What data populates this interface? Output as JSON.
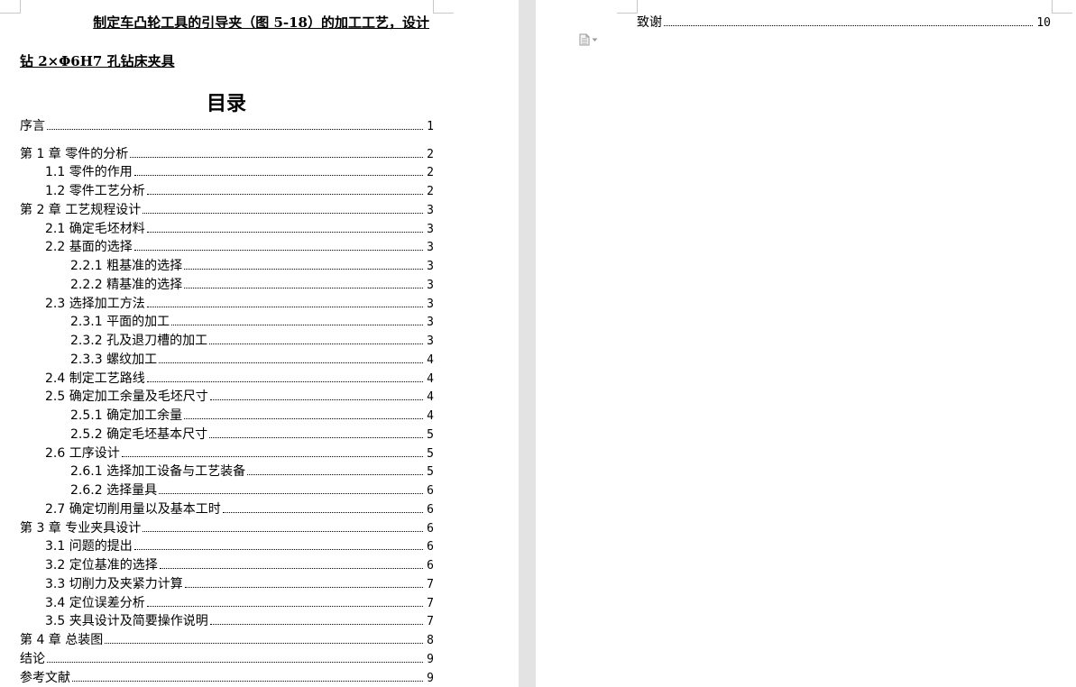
{
  "document": {
    "title": "制定车凸轮工具的引导夹（图 5-18）的加工工艺，设计",
    "subtitle": "钻 2×Φ6H7 孔钻床夹具",
    "toc_heading": "目录"
  },
  "toc_left": [
    {
      "label": "序言",
      "page": "1",
      "level": 0
    },
    {
      "label": "第 1 章  零件的分析",
      "page": "2",
      "level": 0
    },
    {
      "label": "1.1 零件的作用",
      "page": "2",
      "level": 1
    },
    {
      "label": "1.2 零件工艺分析",
      "page": "2",
      "level": 1
    },
    {
      "label": "第 2 章  工艺规程设计",
      "page": "3",
      "level": 0
    },
    {
      "label": "2.1 确定毛坯材料",
      "page": "3",
      "level": 1
    },
    {
      "label": "2.2 基面的选择",
      "page": "3",
      "level": 1
    },
    {
      "label": "2.2.1 粗基准的选择",
      "page": "3",
      "level": 2
    },
    {
      "label": "2.2.2 精基准的选择",
      "page": "3",
      "level": 2
    },
    {
      "label": "2.3 选择加工方法",
      "page": "3",
      "level": 1
    },
    {
      "label": "2.3.1 平面的加工",
      "page": "3",
      "level": 2
    },
    {
      "label": "2.3.2 孔及退刀槽的加工",
      "page": "3",
      "level": 2
    },
    {
      "label": "2.3.3 螺纹加工",
      "page": "4",
      "level": 2
    },
    {
      "label": "2.4 制定工艺路线",
      "page": "4",
      "level": 1
    },
    {
      "label": "2.5 确定加工余量及毛坯尺寸",
      "page": "4",
      "level": 1
    },
    {
      "label": "2.5.1 确定加工余量",
      "page": "4",
      "level": 2
    },
    {
      "label": "2.5.2 确定毛坯基本尺寸",
      "page": "5",
      "level": 2
    },
    {
      "label": "2.6 工序设计",
      "page": "5",
      "level": 1
    },
    {
      "label": "2.6.1 选择加工设备与工艺装备",
      "page": "5",
      "level": 2
    },
    {
      "label": "2.6.2 选择量具",
      "page": "6",
      "level": 2
    },
    {
      "label": "2.7 确定切削用量以及基本工时",
      "page": "6",
      "level": 1
    },
    {
      "label": "第 3 章  专业夹具设计",
      "page": "6",
      "level": 0
    },
    {
      "label": "3.1 问题的提出",
      "page": "6",
      "level": 1
    },
    {
      "label": "3.2 定位基准的选择",
      "page": "6",
      "level": 1
    },
    {
      "label": "3.3 切削力及夹紧力计算",
      "page": "7",
      "level": 1
    },
    {
      "label": "3.4 定位误差分析",
      "page": "7",
      "level": 1
    },
    {
      "label": "3.5 夹具设计及简要操作说明",
      "page": "7",
      "level": 1
    },
    {
      "label": "第 4 章  总装图",
      "page": "8",
      "level": 0
    },
    {
      "label": "结论",
      "page": "9",
      "level": 0
    },
    {
      "label": "参考文献",
      "page": "9",
      "level": 0
    }
  ],
  "toc_right": [
    {
      "label": "致谢",
      "page": "10",
      "level": 0
    }
  ],
  "icons": {
    "doc_options": "document-options-icon"
  },
  "colors": {
    "gutter": "#e3e3e3",
    "text": "#000000"
  }
}
